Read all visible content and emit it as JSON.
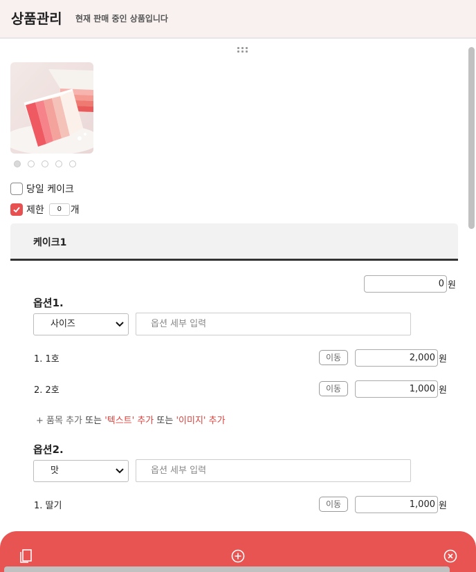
{
  "header": {
    "title": "상품관리",
    "subtitle": "현재 판매 중인 상품입니다"
  },
  "gallery": {
    "image_icon": "cake-photo",
    "dot_count": 5,
    "active_index": 0
  },
  "options_flags": {
    "same_day": {
      "label": "당일 케이크",
      "checked": false
    },
    "limit": {
      "label": "제한",
      "checked": true,
      "value": "0",
      "unit": "개"
    }
  },
  "group": {
    "title": "케이크1",
    "base_price": "0",
    "currency": "원"
  },
  "option1": {
    "title": "옵션1.",
    "select_value": "사이즈",
    "detail_placeholder": "옵션 세부 입력",
    "items": [
      {
        "label": "1. 1호",
        "move": "이동",
        "price": "2,000",
        "unit": "원"
      },
      {
        "label": "2. 2호",
        "move": "이동",
        "price": "1,000",
        "unit": "원"
      }
    ]
  },
  "add_line": {
    "prefix": "+ 품목 추가",
    "or1": " 또는 ",
    "text_add": "'텍스트' 추가",
    "or2": " 또는 ",
    "image_add": "'이미지' 추가"
  },
  "option2": {
    "title": "옵션2.",
    "select_value": "맛",
    "detail_placeholder": "옵션 세부 입력",
    "items": [
      {
        "label": "1. 딸기",
        "move": "이동",
        "price": "1,000",
        "unit": "원"
      }
    ]
  },
  "bottom_bar": {
    "color": "#e85452",
    "icons": [
      "copy-icon",
      "add-circle-icon",
      "close-circle-icon"
    ]
  },
  "colors": {
    "accent": "#e85152",
    "header_bg": "#f8f1f0"
  }
}
